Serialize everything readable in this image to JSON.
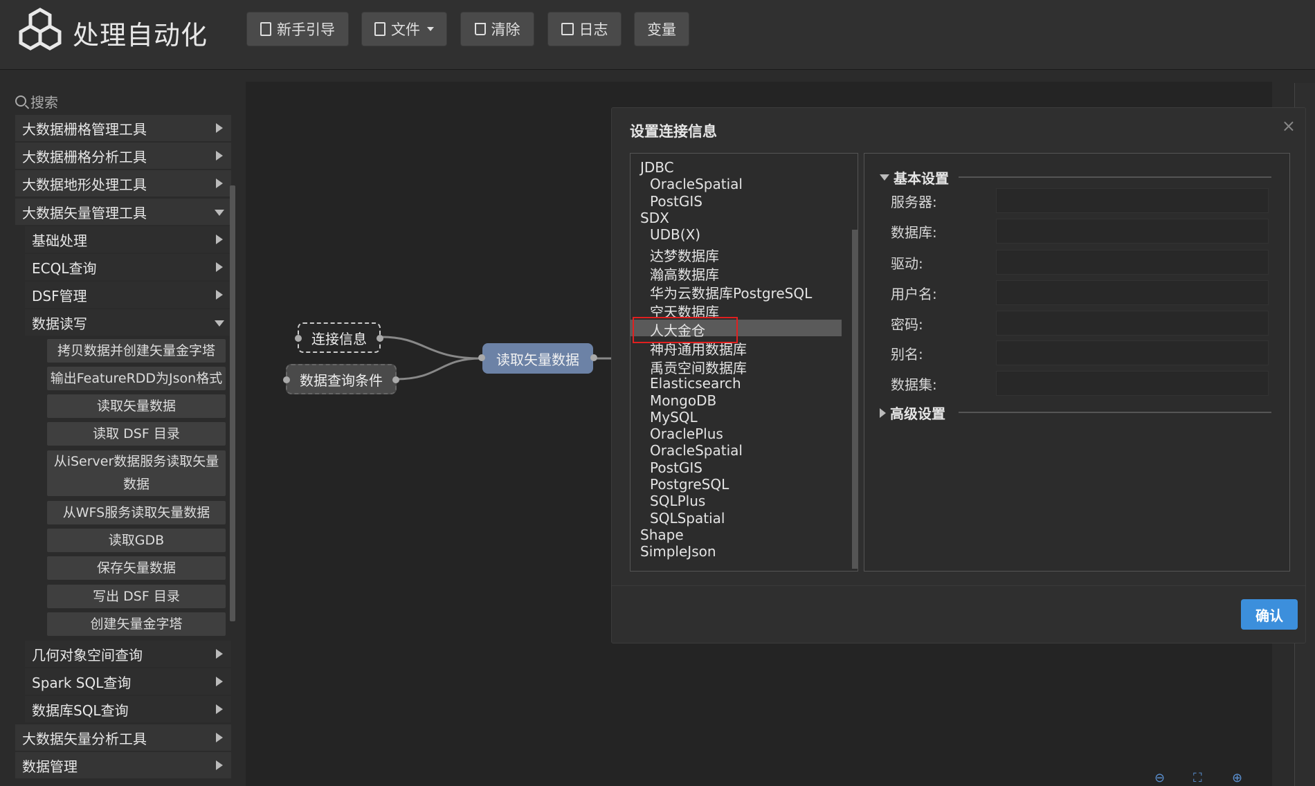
{
  "app": {
    "title": "处理自动化"
  },
  "toolbar": {
    "guide": "新手引导",
    "file": "文件",
    "clear": "清除",
    "log": "日志",
    "variables": "变量"
  },
  "sidebar": {
    "search_placeholder": "搜索",
    "top": [
      "大数据栅格管理工具",
      "大数据栅格分析工具",
      "大数据地形处理工具",
      "大数据矢量管理工具"
    ],
    "vector_sub": [
      "基础处理",
      "ECQL查询",
      "DSF管理",
      "数据读写"
    ],
    "leaves": [
      "拷贝数据并创建矢量金字塔",
      "输出FeatureRDD为Json格式",
      "读取矢量数据",
      "读取 DSF 目录",
      "从iServer数据服务读取矢量数据",
      "从WFS服务读取矢量数据",
      "读取GDB",
      "保存矢量数据",
      "写出 DSF 目录",
      "创建矢量金字塔"
    ],
    "vector_sub2": [
      "几何对象空间查询",
      "Spark SQL查询",
      "数据库SQL查询"
    ],
    "bottom": [
      "大数据矢量分析工具",
      "数据管理"
    ]
  },
  "canvas": {
    "nodes": {
      "conn": "连接信息",
      "query": "数据查询条件",
      "read": "读取矢量数据"
    }
  },
  "dialog": {
    "title": "设置连接信息",
    "close": "×",
    "tree": [
      {
        "label": "JDBC",
        "level": 0
      },
      {
        "label": "OracleSpatial",
        "level": 1
      },
      {
        "label": "PostGIS",
        "level": 1
      },
      {
        "label": "SDX",
        "level": 0
      },
      {
        "label": "UDB(X)",
        "level": 1
      },
      {
        "label": "达梦数据库",
        "level": 1
      },
      {
        "label": "瀚高数据库",
        "level": 1
      },
      {
        "label": "华为云数据库PostgreSQL",
        "level": 1
      },
      {
        "label": "空天数据库",
        "level": 1
      },
      {
        "label": "人大金仓",
        "level": 1,
        "selected": true
      },
      {
        "label": "神舟通用数据库",
        "level": 1
      },
      {
        "label": "禹贡空间数据库",
        "level": 1
      },
      {
        "label": "Elasticsearch",
        "level": 1
      },
      {
        "label": "MongoDB",
        "level": 1
      },
      {
        "label": "MySQL",
        "level": 1
      },
      {
        "label": "OraclePlus",
        "level": 1
      },
      {
        "label": "OracleSpatial",
        "level": 1
      },
      {
        "label": "PostGIS",
        "level": 1
      },
      {
        "label": "PostgreSQL",
        "level": 1
      },
      {
        "label": "SQLPlus",
        "level": 1
      },
      {
        "label": "SQLSpatial",
        "level": 1
      },
      {
        "label": "Shape",
        "level": 0
      },
      {
        "label": "SimpleJson",
        "level": 0
      }
    ],
    "basic_title": "基本设置",
    "advanced_title": "高级设置",
    "fields": [
      {
        "label": "服务器:",
        "value": ""
      },
      {
        "label": "数据库:",
        "value": ""
      },
      {
        "label": "驱动:",
        "value": ""
      },
      {
        "label": "用户名:",
        "value": ""
      },
      {
        "label": "密码:",
        "value": ""
      },
      {
        "label": "别名:",
        "value": ""
      },
      {
        "label": "数据集:",
        "value": ""
      }
    ],
    "confirm": "确认"
  },
  "colors": {
    "accent": "#3c8fdc",
    "selection_outline": "#e02020",
    "node_blue": "#6c82a6"
  }
}
